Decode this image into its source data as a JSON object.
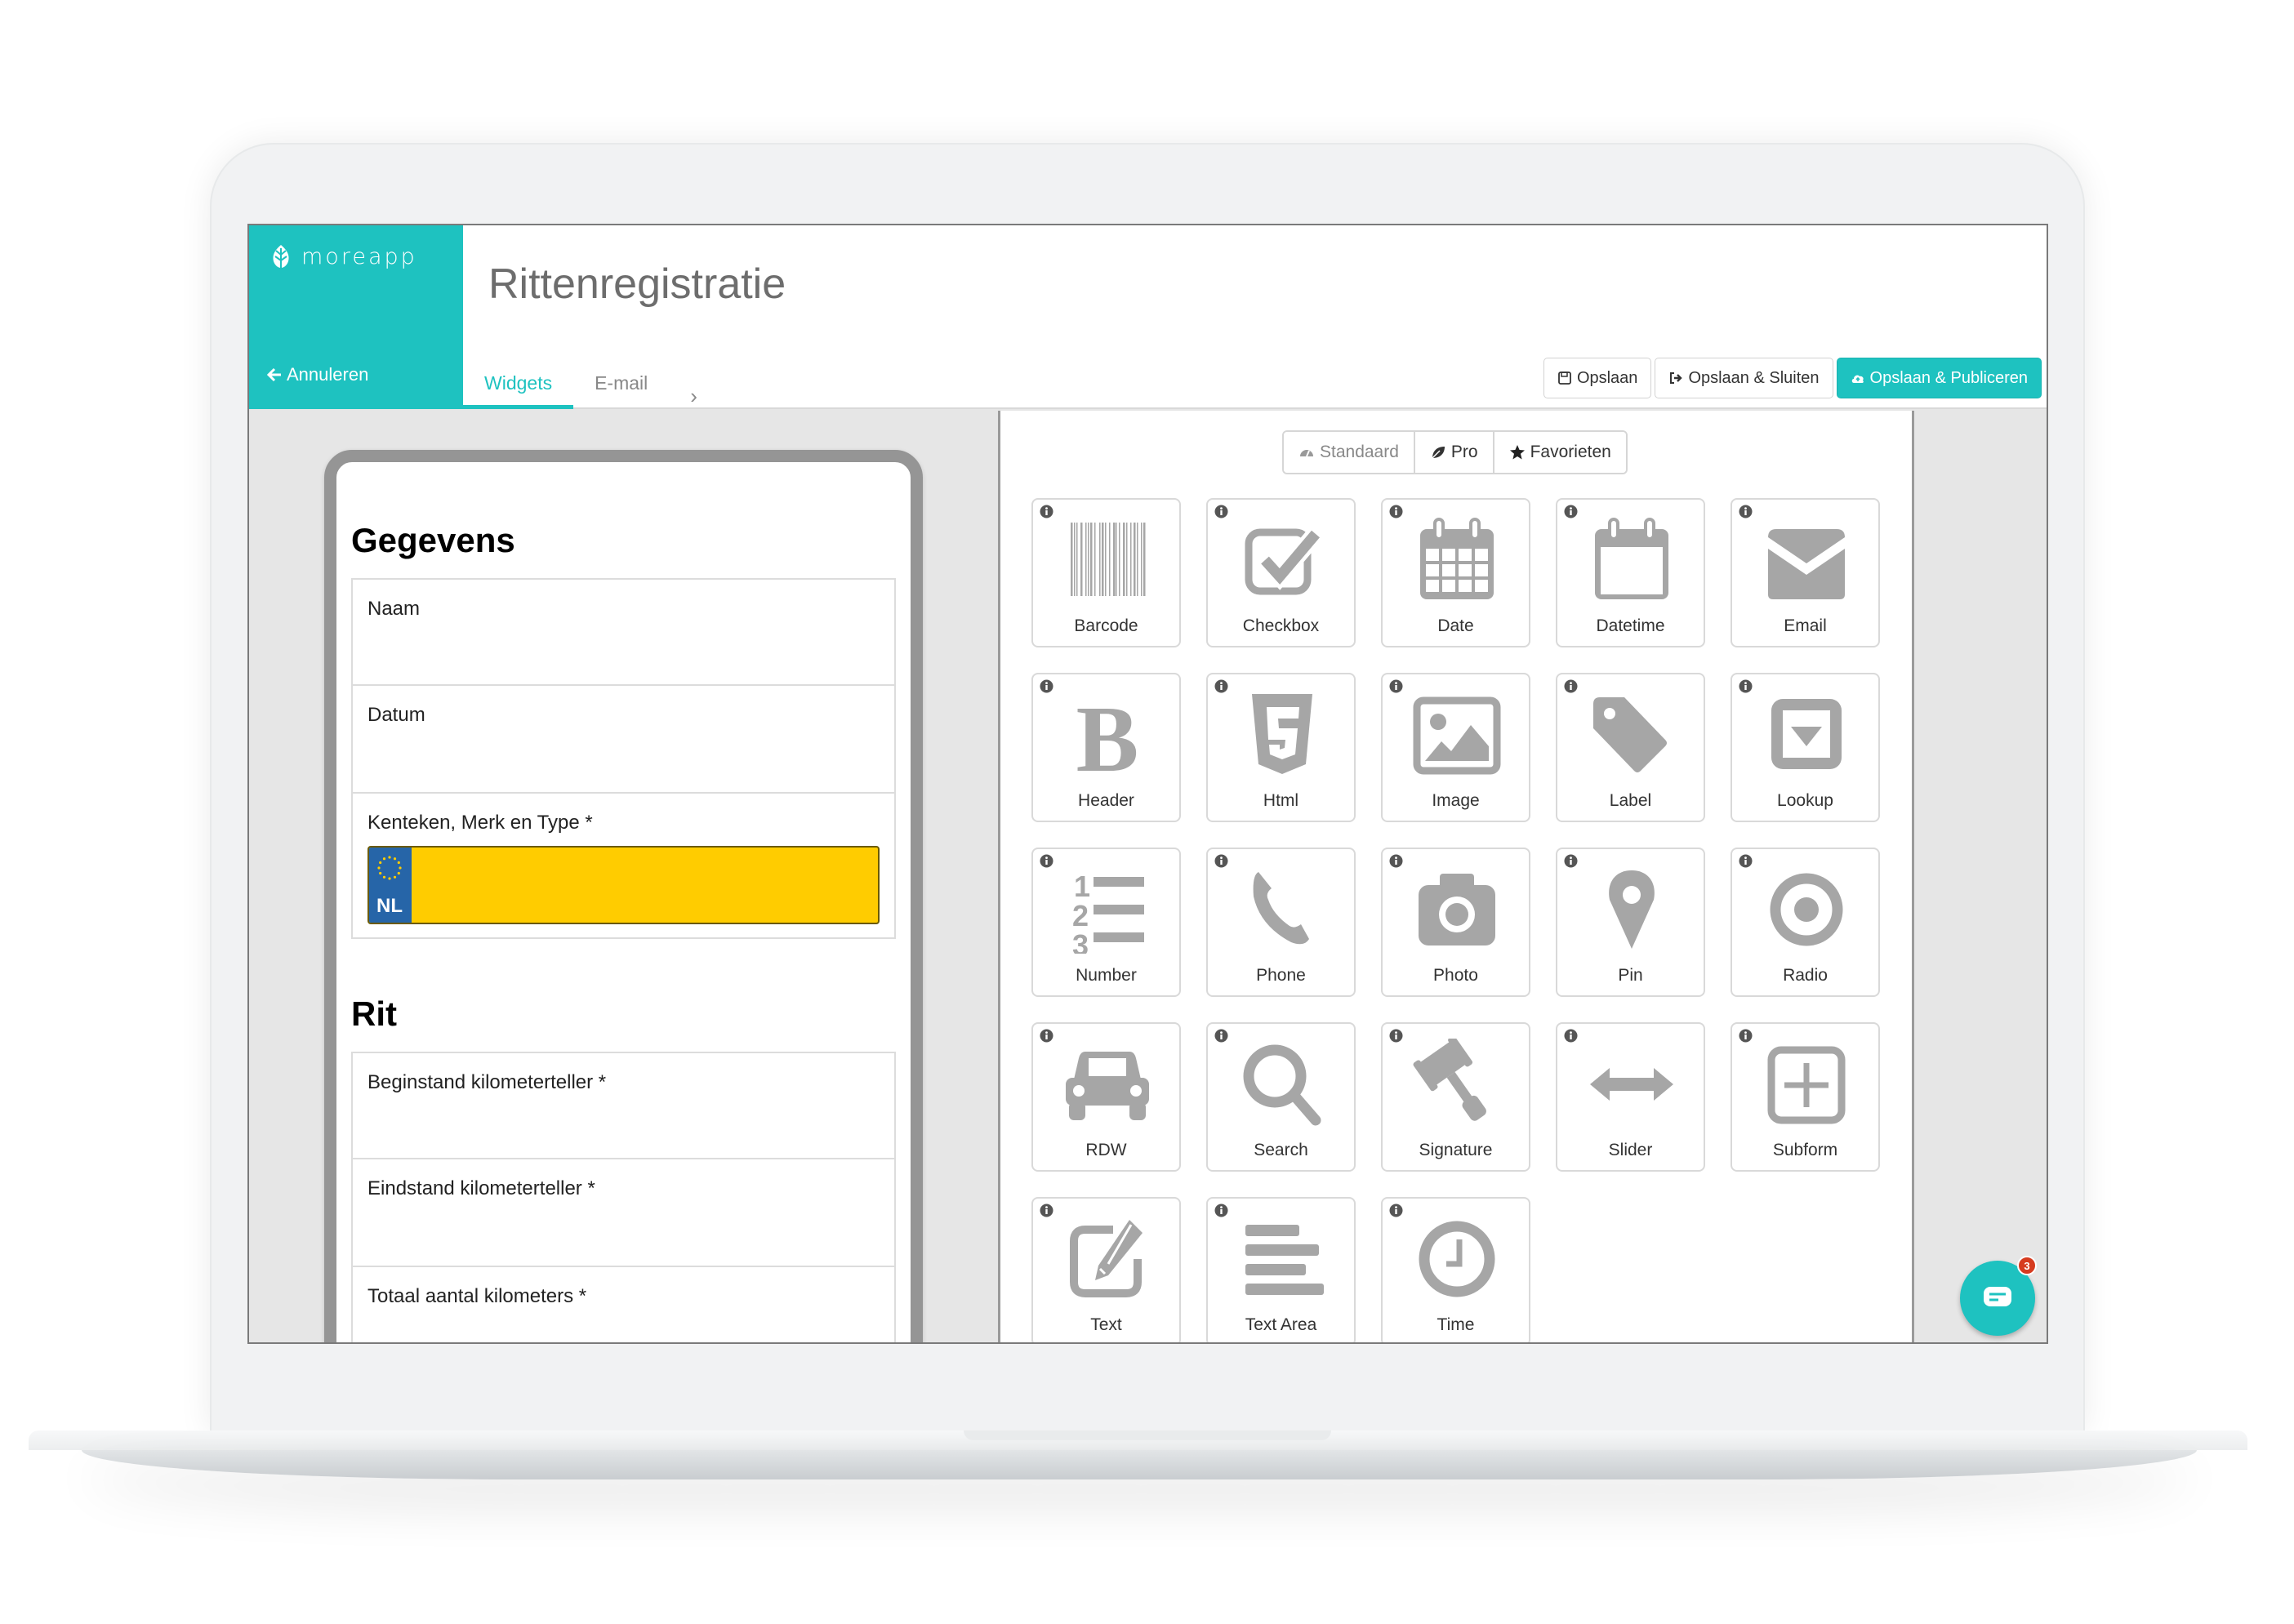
{
  "app": {
    "brand": "moreapp",
    "cancel_label": "Annuleren",
    "title": "Rittenregistratie"
  },
  "tabs": [
    {
      "label": "Widgets",
      "active": true
    },
    {
      "label": "E-mail",
      "active": false
    }
  ],
  "actions": {
    "save": "Opslaan",
    "save_close": "Opslaan & Sluiten",
    "save_publish": "Opslaan & Publiceren"
  },
  "colors": {
    "brand": "#1ec2c0",
    "plate_yellow": "#ffcc00",
    "plate_blue": "#2665a8",
    "badge_red": "#d63b1f",
    "icon_gray": "#a6a6a6"
  },
  "form_preview": {
    "sections": [
      {
        "title": "Gegevens",
        "fields": [
          {
            "label": "Naam"
          },
          {
            "label": "Datum"
          },
          {
            "label": "Kenteken, Merk en Type *",
            "plate_country": "NL"
          }
        ]
      },
      {
        "title": "Rit",
        "fields": [
          {
            "label": "Beginstand kilometerteller *"
          },
          {
            "label": "Eindstand kilometerteller *"
          },
          {
            "label": "Totaal aantal kilometers *"
          }
        ]
      }
    ]
  },
  "widget_categories": [
    {
      "label": "Standaard",
      "icon": "dashboard-icon"
    },
    {
      "label": "Pro",
      "icon": "leaf-icon"
    },
    {
      "label": "Favorieten",
      "icon": "star-icon"
    }
  ],
  "widgets": [
    {
      "label": "Barcode",
      "icon": "barcode-icon"
    },
    {
      "label": "Checkbox",
      "icon": "checkbox-icon"
    },
    {
      "label": "Date",
      "icon": "calendar-icon"
    },
    {
      "label": "Datetime",
      "icon": "calendar-blank-icon"
    },
    {
      "label": "Email",
      "icon": "envelope-icon"
    },
    {
      "label": "Header",
      "icon": "bold-icon"
    },
    {
      "label": "Html",
      "icon": "html5-icon"
    },
    {
      "label": "Image",
      "icon": "image-icon"
    },
    {
      "label": "Label",
      "icon": "tag-icon"
    },
    {
      "label": "Lookup",
      "icon": "dropdown-icon"
    },
    {
      "label": "Number",
      "icon": "ordered-list-icon"
    },
    {
      "label": "Phone",
      "icon": "phone-icon"
    },
    {
      "label": "Photo",
      "icon": "camera-icon"
    },
    {
      "label": "Pin",
      "icon": "map-pin-icon"
    },
    {
      "label": "Radio",
      "icon": "radio-icon"
    },
    {
      "label": "RDW",
      "icon": "car-icon"
    },
    {
      "label": "Search",
      "icon": "search-icon"
    },
    {
      "label": "Signature",
      "icon": "gavel-icon"
    },
    {
      "label": "Slider",
      "icon": "arrows-horizontal-icon"
    },
    {
      "label": "Subform",
      "icon": "plus-square-icon"
    },
    {
      "label": "Text",
      "icon": "edit-icon"
    },
    {
      "label": "Text Area",
      "icon": "align-left-icon"
    },
    {
      "label": "Time",
      "icon": "clock-icon"
    }
  ],
  "chat": {
    "badge_count": "3"
  }
}
